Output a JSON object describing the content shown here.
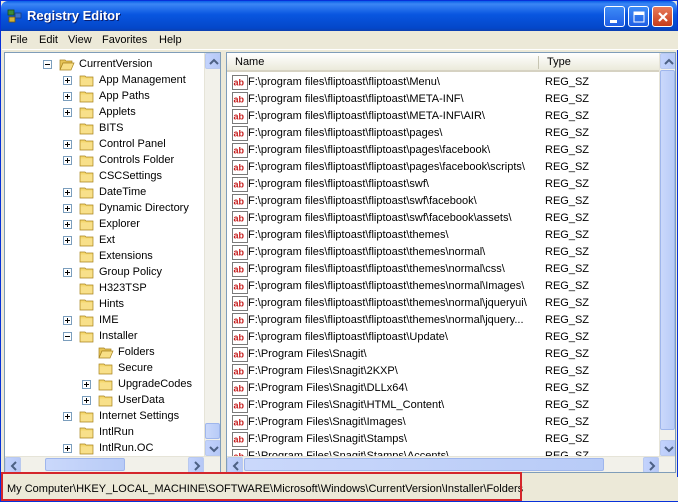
{
  "window": {
    "title": "Registry Editor"
  },
  "menu": [
    "File",
    "Edit",
    "View",
    "Favorites",
    "Help"
  ],
  "tree": {
    "root": "CurrentVersion",
    "items": [
      {
        "label": "App Management",
        "expander": "plus"
      },
      {
        "label": "App Paths",
        "expander": "plus"
      },
      {
        "label": "Applets",
        "expander": "plus"
      },
      {
        "label": "BITS",
        "expander": "none"
      },
      {
        "label": "Control Panel",
        "expander": "plus"
      },
      {
        "label": "Controls Folder",
        "expander": "plus"
      },
      {
        "label": "CSCSettings",
        "expander": "none"
      },
      {
        "label": "DateTime",
        "expander": "plus"
      },
      {
        "label": "Dynamic Directory",
        "expander": "plus"
      },
      {
        "label": "Explorer",
        "expander": "plus"
      },
      {
        "label": "Ext",
        "expander": "plus"
      },
      {
        "label": "Extensions",
        "expander": "none"
      },
      {
        "label": "Group Policy",
        "expander": "plus"
      },
      {
        "label": "H323TSP",
        "expander": "none"
      },
      {
        "label": "Hints",
        "expander": "none"
      },
      {
        "label": "IME",
        "expander": "plus"
      },
      {
        "label": "Installer",
        "expander": "minus"
      }
    ],
    "installer_children": [
      {
        "label": "Folders",
        "expander": "none",
        "open": true
      },
      {
        "label": "Secure",
        "expander": "none"
      },
      {
        "label": "UpgradeCodes",
        "expander": "plus"
      },
      {
        "label": "UserData",
        "expander": "plus"
      }
    ],
    "after": [
      {
        "label": "Internet Settings",
        "expander": "plus"
      },
      {
        "label": "IntlRun",
        "expander": "none"
      },
      {
        "label": "IntlRun.OC",
        "expander": "plus"
      }
    ]
  },
  "list": {
    "columns": {
      "name": "Name",
      "type": "Type"
    },
    "rows": [
      {
        "name": "F:\\program files\\fliptoast\\fliptoast\\Menu\\",
        "type": "REG_SZ"
      },
      {
        "name": "F:\\program files\\fliptoast\\fliptoast\\META-INF\\",
        "type": "REG_SZ"
      },
      {
        "name": "F:\\program files\\fliptoast\\fliptoast\\META-INF\\AIR\\",
        "type": "REG_SZ"
      },
      {
        "name": "F:\\program files\\fliptoast\\fliptoast\\pages\\",
        "type": "REG_SZ"
      },
      {
        "name": "F:\\program files\\fliptoast\\fliptoast\\pages\\facebook\\",
        "type": "REG_SZ"
      },
      {
        "name": "F:\\program files\\fliptoast\\fliptoast\\pages\\facebook\\scripts\\",
        "type": "REG_SZ"
      },
      {
        "name": "F:\\program files\\fliptoast\\fliptoast\\swf\\",
        "type": "REG_SZ"
      },
      {
        "name": "F:\\program files\\fliptoast\\fliptoast\\swf\\facebook\\",
        "type": "REG_SZ"
      },
      {
        "name": "F:\\program files\\fliptoast\\fliptoast\\swf\\facebook\\assets\\",
        "type": "REG_SZ"
      },
      {
        "name": "F:\\program files\\fliptoast\\fliptoast\\themes\\",
        "type": "REG_SZ"
      },
      {
        "name": "F:\\program files\\fliptoast\\fliptoast\\themes\\normal\\",
        "type": "REG_SZ"
      },
      {
        "name": "F:\\program files\\fliptoast\\fliptoast\\themes\\normal\\css\\",
        "type": "REG_SZ"
      },
      {
        "name": "F:\\program files\\fliptoast\\fliptoast\\themes\\normal\\Images\\",
        "type": "REG_SZ"
      },
      {
        "name": "F:\\program files\\fliptoast\\fliptoast\\themes\\normal\\jqueryui\\",
        "type": "REG_SZ"
      },
      {
        "name": "F:\\program files\\fliptoast\\fliptoast\\themes\\normal\\jquery...",
        "type": "REG_SZ"
      },
      {
        "name": "F:\\program files\\fliptoast\\fliptoast\\Update\\",
        "type": "REG_SZ"
      },
      {
        "name": "F:\\Program Files\\Snagit\\",
        "type": "REG_SZ"
      },
      {
        "name": "F:\\Program Files\\Snagit\\2KXP\\",
        "type": "REG_SZ"
      },
      {
        "name": "F:\\Program Files\\Snagit\\DLLx64\\",
        "type": "REG_SZ"
      },
      {
        "name": "F:\\Program Files\\Snagit\\HTML_Content\\",
        "type": "REG_SZ"
      },
      {
        "name": "F:\\Program Files\\Snagit\\Images\\",
        "type": "REG_SZ"
      },
      {
        "name": "F:\\Program Files\\Snagit\\Stamps\\",
        "type": "REG_SZ"
      },
      {
        "name": "F:\\Program Files\\Snagit\\Stamps\\Accents\\",
        "type": "REG_SZ"
      }
    ]
  },
  "status": {
    "path": "My Computer\\HKEY_LOCAL_MACHINE\\SOFTWARE\\Microsoft\\Windows\\CurrentVersion\\Installer\\Folders"
  },
  "icons": {
    "app": "registry-icon",
    "folder": "folder-icon",
    "value": "string-value-icon",
    "minimize": "minimize-icon",
    "maximize": "maximize-icon",
    "close": "close-icon"
  },
  "colors": {
    "titlebar": "#0a5fe8",
    "close": "#c73c1b",
    "highlight": "#d4262c",
    "folder": "#f5d76e"
  }
}
